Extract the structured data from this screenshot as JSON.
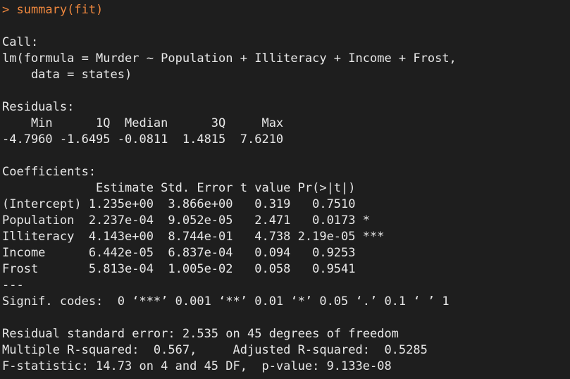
{
  "colors": {
    "background": "#1e1e1e",
    "output_text": "#e8e8e8",
    "command_text": "#f0883e"
  },
  "console": {
    "command": "> summary(fit)",
    "call_header": "Call:",
    "call_line1": "lm(formula = Murder ~ Population + Illiteracy + Income + Frost,",
    "call_line2": "    data = states)",
    "residuals_header": "Residuals:",
    "residuals_labels": "    Min      1Q  Median      3Q     Max ",
    "residuals_values": "-4.7960 -1.6495 -0.0811  1.4815  7.6210 ",
    "coefficients_header": "Coefficients:",
    "coef_columns": "             Estimate Std. Error t value Pr(>|t|)    ",
    "coef_rows": [
      "(Intercept) 1.235e+00  3.866e+00   0.319   0.7510    ",
      "Population  2.237e-04  9.052e-05   2.471   0.0173 *  ",
      "Illiteracy  4.143e+00  8.744e-01   4.738 2.19e-05 ***",
      "Income      6.442e-05  6.837e-04   0.094   0.9253    ",
      "Frost       5.813e-04  1.005e-02   0.058   0.9541    "
    ],
    "separator": "---",
    "signif_codes": "Signif. codes:  0 ‘***’ 0.001 ‘**’ 0.01 ‘*’ 0.05 ‘.’ 0.1 ‘ ’ 1",
    "residual_se": "Residual standard error: 2.535 on 45 degrees of freedom",
    "r_squared": "Multiple R-squared:  0.567,\tAdjusted R-squared:  0.5285 ",
    "f_statistic": "F-statistic: 14.73 on 4 and 45 DF,  p-value: 9.133e-08"
  }
}
